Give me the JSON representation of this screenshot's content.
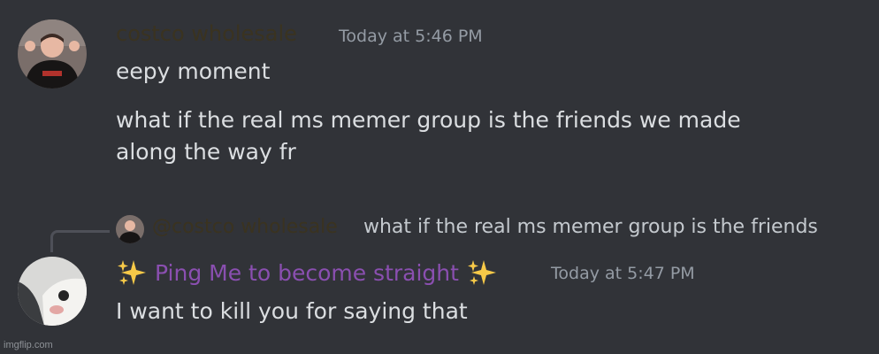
{
  "messages": [
    {
      "author": "costco wholesale",
      "timestamp": "Today at 5:46 PM",
      "lines": [
        "eepy moment",
        "what if the real ms memer group is the friends we made",
        "along the way fr"
      ]
    },
    {
      "reply": {
        "author": "@costco wholesale",
        "preview": "what if the real ms memer group is the friends"
      },
      "author_name": "Ping Me to become straight",
      "timestamp": "Today at 5:47 PM",
      "text": "I want to kill you for saying that"
    }
  ],
  "icons": {
    "sparkle": "sparkles-icon"
  },
  "colors": {
    "background": "#313338",
    "message_text": "#dbdee1",
    "timestamp": "#949ba4",
    "first_username": "#3a3320",
    "second_username": "#8a4fb0"
  },
  "watermark": "imgflip.com"
}
